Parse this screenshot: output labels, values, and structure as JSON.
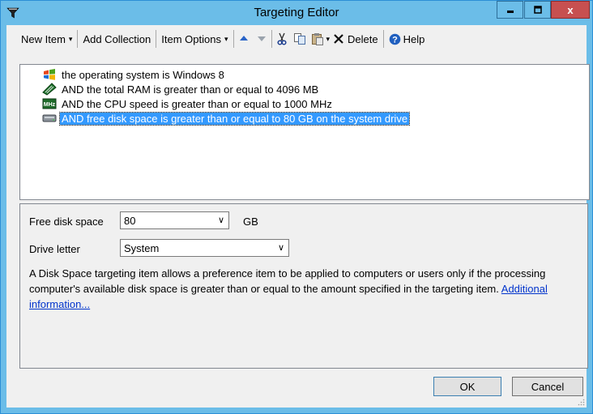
{
  "window": {
    "title": "Targeting Editor",
    "app_icon": "filter-funnel-icon",
    "controls": [
      "minimize-icon",
      "maximize-icon",
      "close-icon"
    ],
    "close_glyph": "x"
  },
  "toolbar": {
    "new_item": "New Item",
    "add_collection": "Add Collection",
    "item_options": "Item Options",
    "delete": "Delete",
    "help": "Help",
    "icons": [
      "move-up-icon",
      "move-down-icon",
      "cut-icon",
      "copy-icon",
      "paste-icon",
      "delete-icon",
      "help-icon"
    ]
  },
  "items": [
    {
      "text": "the operating system is Windows 8",
      "icon": "windows-icon"
    },
    {
      "text": "AND the total RAM is greater than or equal to 4096 MB",
      "icon": "ram-icon"
    },
    {
      "text": "AND the CPU speed is greater than or equal to 1000 MHz",
      "icon": "cpu-mhz-icon",
      "icon_label": "MHz"
    },
    {
      "text": "AND free disk space is greater than or equal to 80 GB on the system drive",
      "icon": "disk-drive-icon",
      "selected": true
    }
  ],
  "properties": {
    "free_disk_space_label": "Free disk space",
    "free_disk_space_value": "80",
    "unit": "GB",
    "drive_letter_label": "Drive letter",
    "drive_letter_value": "System",
    "description": "A Disk Space targeting item allows a preference item to be applied to computers or users only if the processing computer's available disk space is greater than or equal to the amount specified in the targeting item.",
    "link": "Additional information..."
  },
  "buttons": {
    "ok": "OK",
    "cancel": "Cancel"
  },
  "colors": {
    "titlebar": "#6bbde8",
    "selection": "#3399ff",
    "close": "#c75050",
    "link": "#0033cc"
  }
}
